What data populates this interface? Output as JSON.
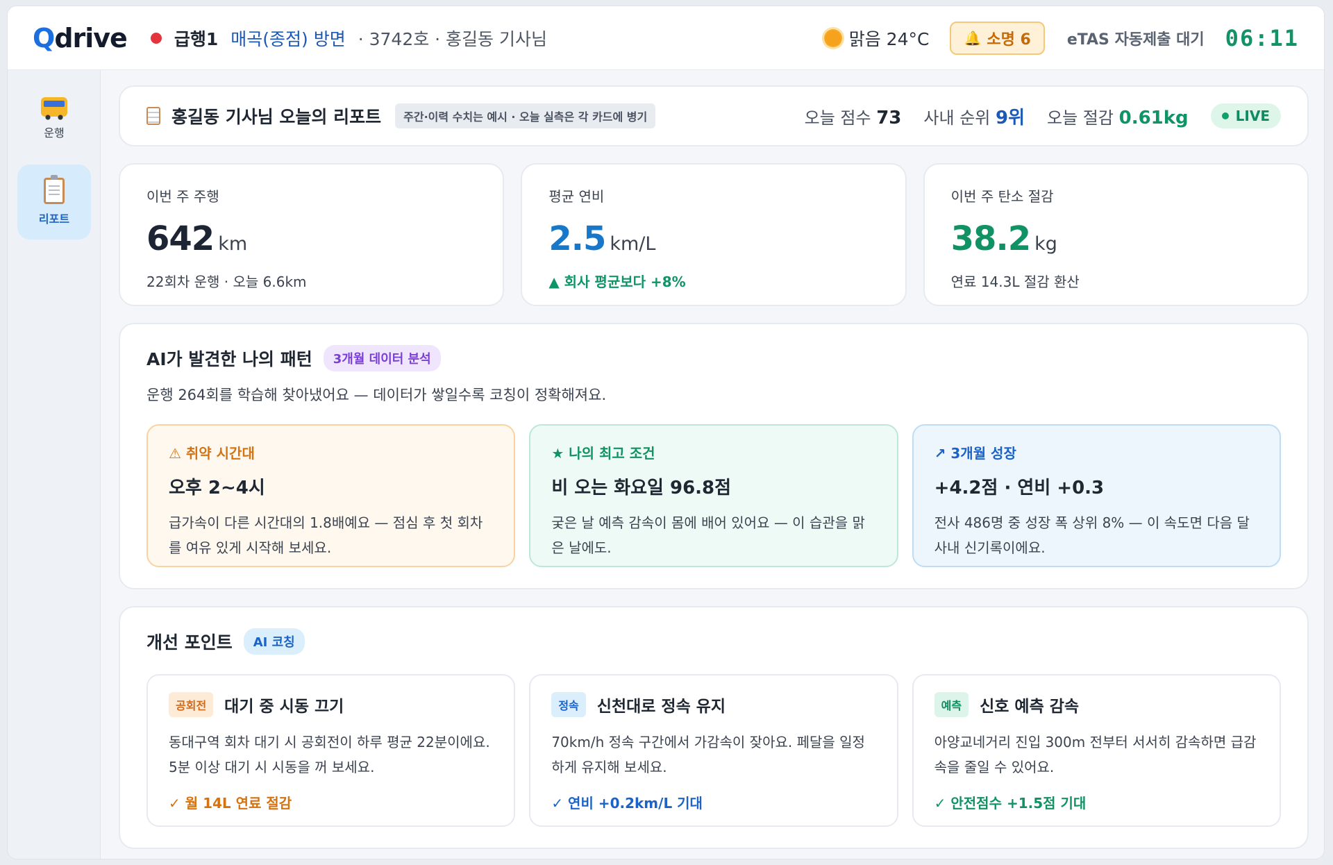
{
  "header": {
    "logo_q": "Q",
    "logo_rest": "drive",
    "route_type": "급행1",
    "route_direction": "매곡(종점) 방면",
    "route_info": "· 3742호 · 홍길동 기사님",
    "weather": "맑음 24°C",
    "alarm": "소명 6",
    "etas": "eTAS 자동제출 대기",
    "clock": "06:11",
    "colors": {
      "route_dot": "#e5343b",
      "clock": "#129266"
    }
  },
  "sidebar": {
    "items": [
      {
        "label": "운행",
        "icon": "bus-icon",
        "active": false
      },
      {
        "label": "리포트",
        "icon": "clipboard-icon",
        "active": true
      }
    ]
  },
  "report": {
    "title": "홍길동 기사님 오늘의 리포트",
    "note": "주간·이력 수치는 예시 · 오늘 실측은 각 카드에 병기",
    "score_label": "오늘 점수",
    "score_value": "73",
    "rank_label": "사내 순위",
    "rank_value": "9위",
    "save_label": "오늘 절감",
    "save_value": "0.61kg",
    "live": "LIVE"
  },
  "kpis": [
    {
      "label": "이번 주 주행",
      "value": "642",
      "unit": "km",
      "sub": "22회차 운행 · 오늘 6.6km"
    },
    {
      "label": "평균 연비",
      "value": "2.5",
      "unit": "km/L",
      "sub": "▲ 회사 평균보다 +8%"
    },
    {
      "label": "이번 주 탄소 절감",
      "value": "38.2",
      "unit": "kg",
      "sub": "연료 14.3L 절감 환산"
    }
  ],
  "patterns": {
    "title": "AI가 발견한 나의 패턴",
    "chip": "3개월 데이터 분석",
    "desc": "운행 264회를 학습해 찾아냈어요 — 데이터가 쌓일수록 코칭이 정확해져요.",
    "cards": [
      {
        "tag": "⚠ 취약 시간대",
        "title": "오후 2~4시",
        "text": "급가속이 다른 시간대의 1.8배예요 — 점심 후 첫 회차를 여유 있게 시작해 보세요."
      },
      {
        "tag": "★ 나의 최고 조건",
        "title": "비 오는 화요일 96.8점",
        "text": "궂은 날 예측 감속이 몸에 배어 있어요 — 이 습관을 맑은 날에도."
      },
      {
        "tag": "↗ 3개월 성장",
        "title": "+4.2점 · 연비 +0.3",
        "text": "전사 486명 중 성장 폭 상위 8% — 이 속도면 다음 달 사내 신기록이에요."
      }
    ]
  },
  "improve": {
    "title": "개선 포인트",
    "chip": "AI 코칭",
    "cards": [
      {
        "tag": "공회전",
        "title": "대기 중 시동 끄기",
        "text": "동대구역 회차 대기 시 공회전이 하루 평균 22분이에요. 5분 이상 대기 시 시동을 꺼 보세요.",
        "benefit": "✓ 월 14L 연료 절감"
      },
      {
        "tag": "정속",
        "title": "신천대로 정속 유지",
        "text": "70km/h 정속 구간에서 가감속이 잦아요. 페달을 일정하게 유지해 보세요.",
        "benefit": "✓ 연비 +0.2km/L 기대"
      },
      {
        "tag": "예측",
        "title": "신호 예측 감속",
        "text": "아양교네거리 진입 300m 전부터 서서히 감속하면 급감속을 줄일 수 있어요.",
        "benefit": "✓ 안전점수 +1.5점 기대"
      }
    ]
  }
}
